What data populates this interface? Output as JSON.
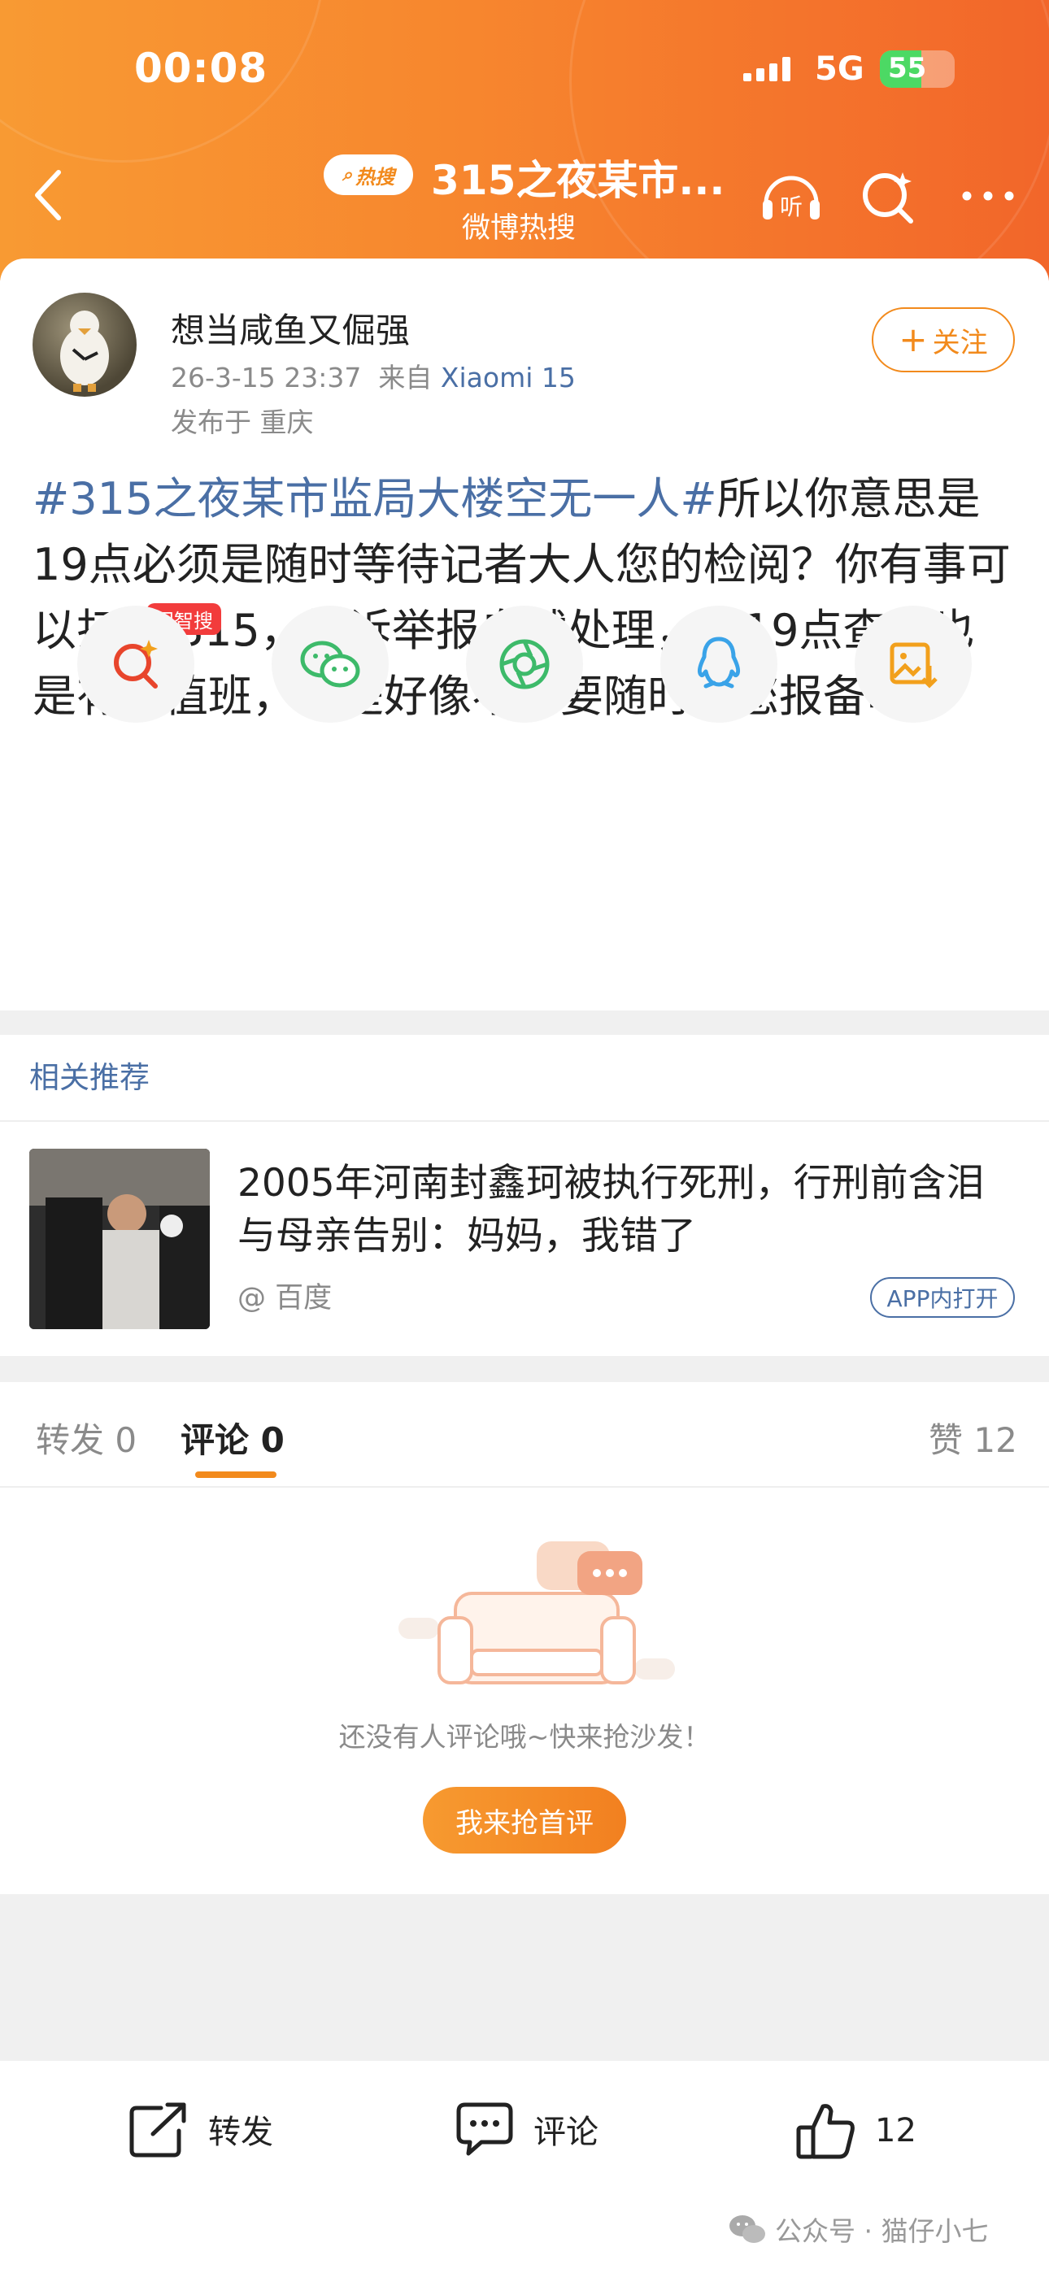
{
  "status_bar": {
    "time": "00:08",
    "network": "5G",
    "battery": "55",
    "battery_level": 0.55
  },
  "nav": {
    "badge": "热搜",
    "title": "315之夜某市...",
    "subtitle": "微博热搜"
  },
  "post": {
    "author": "想当咸鱼又倔强",
    "datetime": "26-3-15 23:37",
    "from_label": "来自",
    "device": "Xiaomi 15",
    "location": "发布于 重庆",
    "follow_label": "关注",
    "hashtag": "#315之夜某市监局大楼空无一人#",
    "body": "所以你意思是19点必须是随时等待记者大人您的检阅？你有事可以打12315，投诉举报自然处理，你19点查岗也是有人值班，但是好像不需要随时给您报备吧？"
  },
  "share": {
    "wzs_badge": "问智搜",
    "icons": [
      "ai-search-icon",
      "wechat-icon",
      "moments-icon",
      "qq-icon",
      "save-image-icon"
    ]
  },
  "recommend": {
    "title": "相关推荐",
    "headline": "2005年河南封鑫珂被执行死刑，行刑前含泪与母亲告别：妈妈，我错了",
    "source": "@ 百度",
    "open_app": "APP内打开"
  },
  "tabs": {
    "repost": "转发 0",
    "comment": "评论 0",
    "like": "赞 12"
  },
  "comments": {
    "empty_text": "还没有人评论哦~快来抢沙发！",
    "first_comment_button": "我来抢首评"
  },
  "bottom_bar": {
    "repost": "转发",
    "comment": "评论",
    "like_count": "12"
  },
  "watermark": "公众号 · 猫仔小七",
  "colors": {
    "accent": "#f28a1c",
    "link": "#4a6fa5"
  }
}
